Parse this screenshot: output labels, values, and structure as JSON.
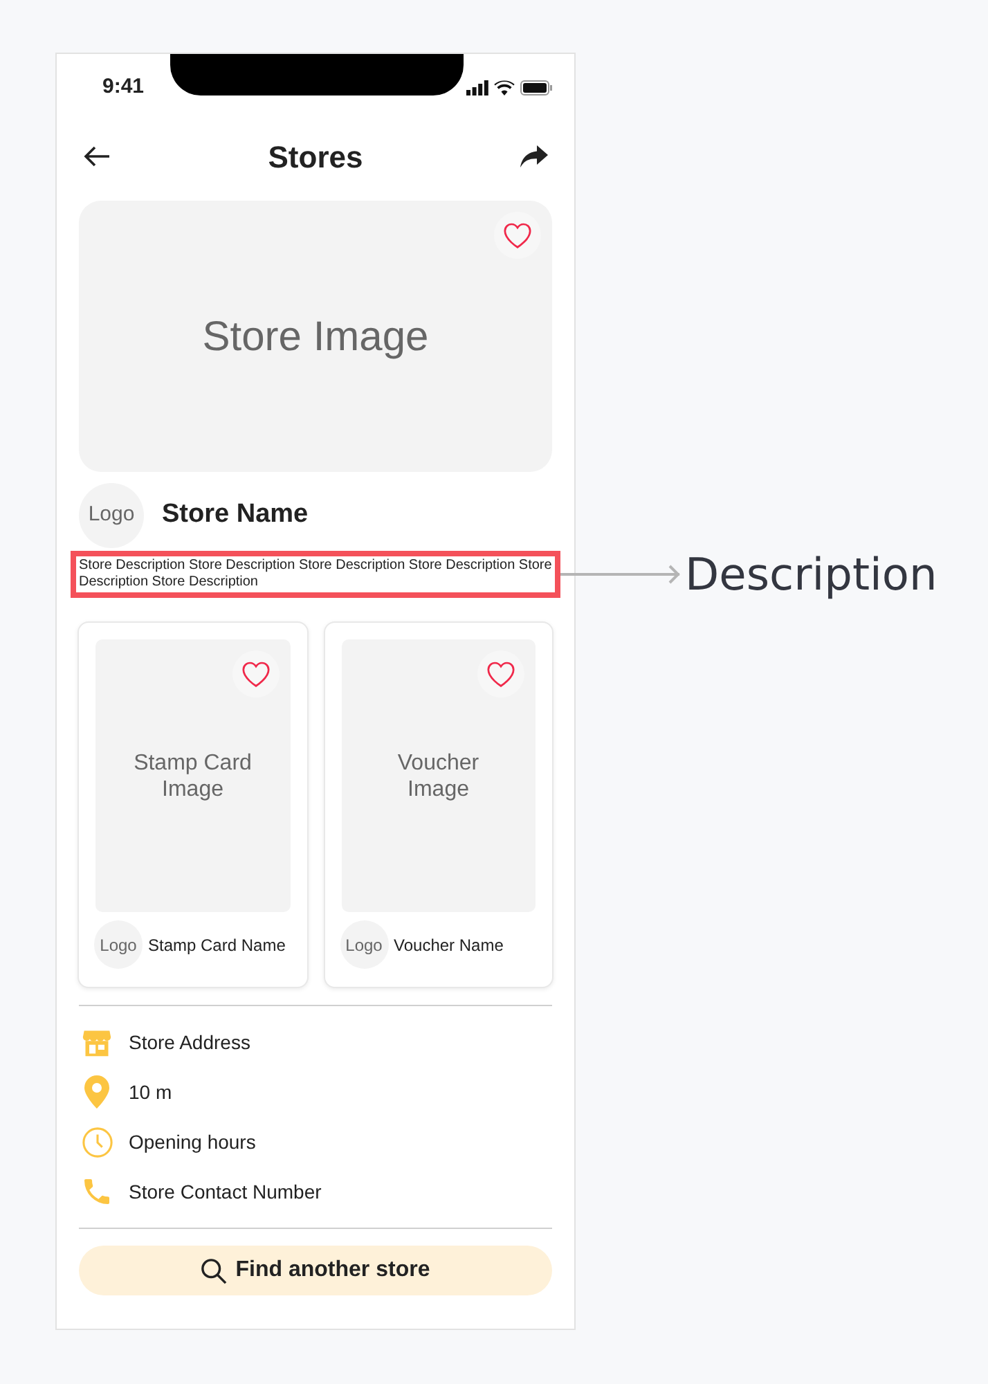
{
  "status_bar": {
    "time": "9:41"
  },
  "header": {
    "title": "Stores"
  },
  "store": {
    "image_label": "Store Image",
    "favorite": false,
    "logo": "Logo",
    "name": "Store Name",
    "description": "Store Description Store Description Store Description Store Description Store Description Store Description"
  },
  "annotation": {
    "label": "Description"
  },
  "cards": [
    {
      "image_label": "Stamp Card Image",
      "favorite": false,
      "logo": "Logo",
      "name": "Stamp Card Name"
    },
    {
      "image_label": "Voucher Image",
      "favorite": false,
      "logo": "Logo",
      "name": "Voucher Name"
    }
  ],
  "info": [
    {
      "kind": "store",
      "text": "Store Address"
    },
    {
      "kind": "pin",
      "text": "10 m"
    },
    {
      "kind": "clock",
      "text": "Opening hours"
    },
    {
      "kind": "phone",
      "text": "Store Contact Number"
    }
  ],
  "button": {
    "label": "Find another store"
  }
}
